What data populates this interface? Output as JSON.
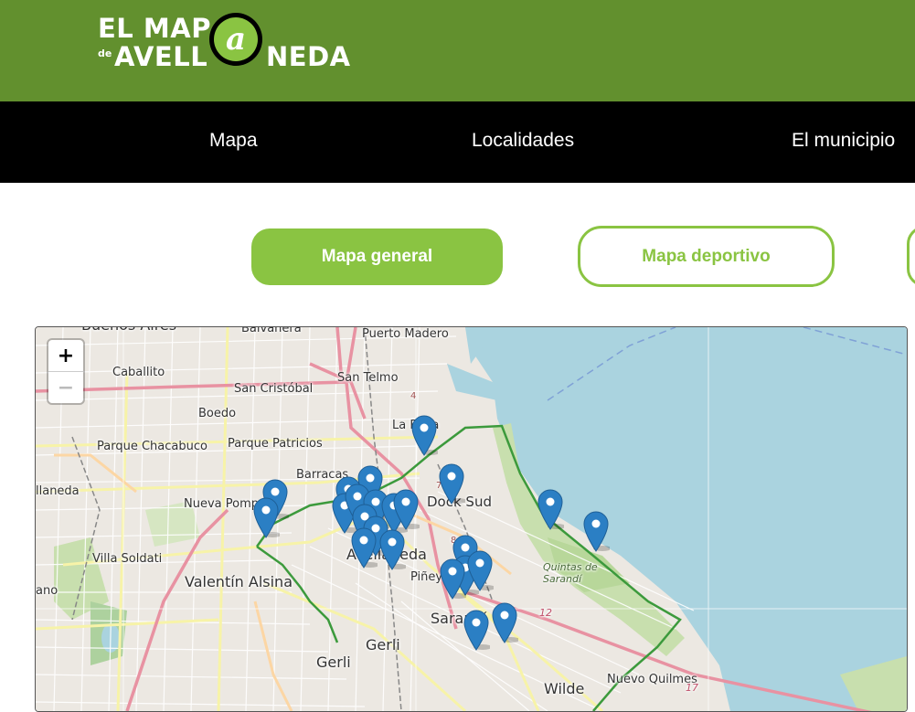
{
  "header": {
    "logo": {
      "line1": "EL MAP",
      "de": "de",
      "line2a": "AVELL",
      "letter": "a",
      "line2b": "NEDA"
    }
  },
  "nav": {
    "items": [
      {
        "label": "Mapa"
      },
      {
        "label": "Localidades"
      },
      {
        "label": "El municipio"
      }
    ]
  },
  "map_buttons": {
    "general": "Mapa general",
    "deportivo": "Mapa deportivo"
  },
  "map": {
    "zoom_in": "+",
    "zoom_out": "−",
    "labels": [
      "Buenos Aires",
      "Balvanera",
      "Puerto Madero",
      "Caballito",
      "San Telmo",
      "San Cristóbal",
      "Boedo",
      "La Boca",
      "Parque Chacabuco",
      "Parque Patricios",
      "Barracas",
      "llaneda",
      "Nueva Pompeya",
      "Dock Sud",
      "Villa Soldati",
      "Valentín Alsina",
      "Avellaneda",
      "Quintas de Sarandí",
      "ano",
      "Piñeyro",
      "Sarandí",
      "Gerli",
      "Gerli",
      "Wilde",
      "Nuevo Quilmes",
      "4",
      "12",
      "17",
      "7",
      "8"
    ]
  },
  "colors": {
    "header_green": "#62902e",
    "accent_green": "#8ac442",
    "nav_black": "#000000",
    "water": "#aad3df",
    "marker_blue": "#2b7fc4",
    "boundary_green": "#3c9a3c"
  }
}
